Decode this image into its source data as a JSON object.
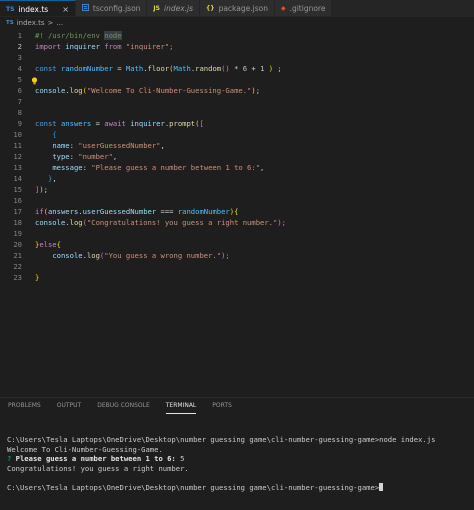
{
  "tabs": [
    {
      "icon": "TS",
      "label": "index.ts",
      "active": true
    },
    {
      "icon": "",
      "label": "tsconfig.json"
    },
    {
      "icon": "JS",
      "label": "index.js"
    },
    {
      "icon": "{}",
      "label": "package.json"
    },
    {
      "icon": "",
      "label": ".gitignore"
    }
  ],
  "breadcrumb": {
    "icon": "TS",
    "file": "index.ts",
    "sep": ">",
    "rest": "..."
  },
  "editor": {
    "line_numbers": [
      "1",
      "2",
      "3",
      "4",
      "5",
      "6",
      "7",
      "8",
      "9",
      "10",
      "11",
      "12",
      "13",
      "14",
      "15",
      "16",
      "17",
      "18",
      "19",
      "20",
      "21",
      "22",
      "23"
    ],
    "lines": {
      "l1a": "#! /usr/bin/env ",
      "l1b": "node",
      "l2a": "import",
      "l2b": " inquirer ",
      "l2c": "from",
      "l2d": " \"inquirer\";",
      "l4a": "const",
      "l4b": " randomNumber",
      "l4c": " = ",
      "l4d": "Math",
      "l4e": ".",
      "l4f": "floor",
      "l4g": "(",
      "l4h": "Math",
      "l4i": ".",
      "l4j": "random",
      "l4k": "()",
      "l4l": " * ",
      "l4m": "6",
      "l4n": " + ",
      "l4o": "1",
      "l4p": " ) ;",
      "l6a": "console",
      "l6b": ".",
      "l6c": "log",
      "l6d": "(",
      "l6e": "\"Welcome To Cli-Number-Guessing-Game.\"",
      "l6f": ");",
      "l9a": "const",
      "l9b": " answers",
      "l9c": " = ",
      "l9d": "await",
      "l9e": " inquirer",
      "l9f": ".",
      "l9g": "prompt",
      "l9h": "(",
      "l9i": "[",
      "l10": "{",
      "l11a": "name",
      "l11b": ": ",
      "l11c": "\"userGuessedNumber\"",
      "l11d": ",",
      "l12a": "type",
      "l12b": ": ",
      "l12c": "\"number\"",
      "l12d": ",",
      "l13a": "message",
      "l13b": ": ",
      "l13c": "\"Please guess a number between 1 to 6:\"",
      "l13d": ",",
      "l14a": "}",
      "l14b": ",",
      "l15a": "]",
      "l15b": ")",
      "l15c": ";",
      "l17a": "if",
      "l17b": "(",
      "l17c": "answers",
      "l17d": ".",
      "l17e": "userGuessedNumber",
      "l17f": " === ",
      "l17g": "randomNumber",
      "l17h": ")",
      "l17i": "{",
      "l18a": "console",
      "l18b": ".",
      "l18c": "log",
      "l18d": "(",
      "l18e": "\"Congratulations! you guess a right number.\"",
      "l18f": ");",
      "l20a": "}",
      "l20b": "else",
      "l20c": "{",
      "l21a": "console",
      "l21b": ".",
      "l21c": "log",
      "l21d": "(",
      "l21e": "\"You guess a wrong number.\"",
      "l21f": ");",
      "l23": "}"
    }
  },
  "panel": {
    "tabs": [
      "PROBLEMS",
      "OUTPUT",
      "DEBUG CONSOLE",
      "TERMINAL",
      "PORTS"
    ],
    "active_tab": "TERMINAL",
    "terminal": {
      "line1": "C:\\Users\\Tesla Laptops\\OneDrive\\Desktop\\number guessing game\\cli-number-guessing-game>node index.js",
      "line2": "Welcome To Cli-Number-Guessing-Game.",
      "line3_q": "?",
      "line3_prompt": " Please guess a number between 1 to 6:",
      "line3_ans": " 5",
      "line4": "Congratulations! you guess a right number.",
      "line6": "C:\\Users\\Tesla Laptops\\OneDrive\\Desktop\\number guessing game\\cli-number-guessing-game>"
    }
  }
}
